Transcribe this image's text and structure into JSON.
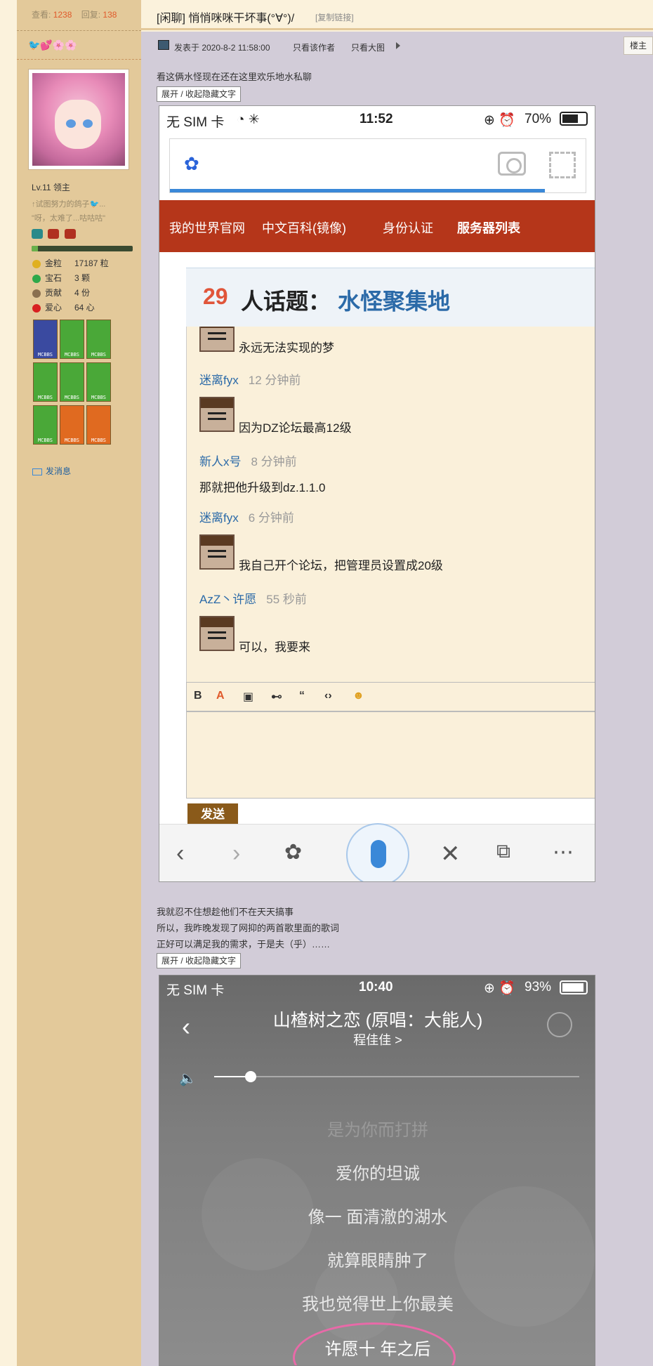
{
  "sidebar": {
    "stats": {
      "views_label": "查看:",
      "views": "1238",
      "replies_label": "回复:",
      "replies": "138"
    },
    "hearts": "🐦💕🌸🌸",
    "level": "Lv.11 领主",
    "signature_line1": "↑试图努力的鸽子🐦...",
    "signature_line2": "\"呀，太难了...咕咕咕\"",
    "xp_fraction": 0.06,
    "items": [
      {
        "label": "金粒",
        "value": "17187 粒",
        "color": "#e0b020"
      },
      {
        "label": "宝石",
        "value": "3 颗",
        "color": "#2ea84a"
      },
      {
        "label": "贡献",
        "value": "4 份",
        "color": "#8a7050"
      },
      {
        "label": "爱心",
        "value": "64 心",
        "color": "#d82020"
      }
    ],
    "badge_label": "MCBBS",
    "send_message": "发消息"
  },
  "thread": {
    "title": "[闲聊] 悄悄咪咪干坏事(°∀°)/",
    "copy_link": "[复制链接]",
    "post_time": "发表于 2020-8-2 11:58:00",
    "only_author": "只看该作者",
    "only_image": "只看大图",
    "floor": "楼主"
  },
  "post": {
    "text1": "看这俩水怪现在还在这里欢乐地水私聊",
    "toggle": "展开 / 收起隐藏文字",
    "text2_line1": "我就忍不住想趁他们不在天天搞事",
    "text2_line2": "所以，我昨晚发现了网抑的两首歌里面的歌词",
    "text2_line3": "正好可以满足我的需求，于是夫（乎）……"
  },
  "screenshot1": {
    "carrier": "无 SIM 卡",
    "time": "11:52",
    "battery": "70%",
    "battery_fraction": 0.7,
    "nav": [
      "我的世界官网",
      "中文百科(镜像)",
      "身份认证",
      "服务器列表"
    ],
    "topic_count": "29",
    "topic_label": "人话题：",
    "topic_name": "水怪聚集地",
    "messages": [
      {
        "text": "永远无法实现的梦"
      },
      {
        "name": "迷离fyx",
        "time": "12 分钟前",
        "text": "因为DZ论坛最高12级"
      },
      {
        "name": "新人x号",
        "time": "8 分钟前",
        "text": "那就把他升级到dz.1.1.0"
      },
      {
        "name": "迷离fyx",
        "time": "6 分钟前",
        "text": "我自己开个论坛，把管理员设置成20级"
      },
      {
        "name": "AzZ丶许愿",
        "time": "55 秒前",
        "text": "可以，我要来"
      }
    ],
    "send": "发送"
  },
  "screenshot2": {
    "carrier": "无 SIM 卡",
    "time": "10:40",
    "battery": "93%",
    "battery_fraction": 0.93,
    "song_title": "山楂树之恋 (原唱：大能人)",
    "artist": "程佳佳 >",
    "volume_fraction": 0.1,
    "lyrics": [
      "是为你而打拼",
      "爱你的坦诚",
      "像一 面清澈的湖水",
      "就算眼睛肿了",
      "我也觉得世上你最美",
      "许愿十 年之后"
    ]
  }
}
